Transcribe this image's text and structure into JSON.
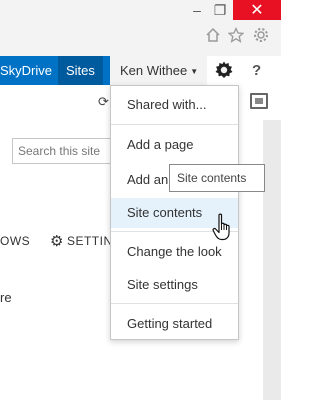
{
  "browser": {
    "minimize": "–",
    "restore": "❐",
    "close": "✕",
    "toolbar_icons": [
      "home-icon",
      "star-icon",
      "gear-icon"
    ]
  },
  "suitebar": {
    "skydrive": "SkyDrive",
    "sites": "Sites",
    "user": "Ken Withee",
    "help": "?",
    "accent": "#0072c6"
  },
  "page": {
    "search_placeholder": "Search this site",
    "follows": "OWS",
    "settings": "SETTIN",
    "fragment": "re"
  },
  "menu": {
    "items": [
      {
        "label": "Shared with..."
      },
      {
        "label": "Add a page"
      },
      {
        "label": "Add an app"
      },
      {
        "label": "Site contents",
        "hovered": true
      },
      {
        "label": "Change the look"
      },
      {
        "label": "Site settings"
      },
      {
        "label": "Getting started"
      }
    ]
  },
  "tooltip": {
    "text": "Site contents"
  }
}
